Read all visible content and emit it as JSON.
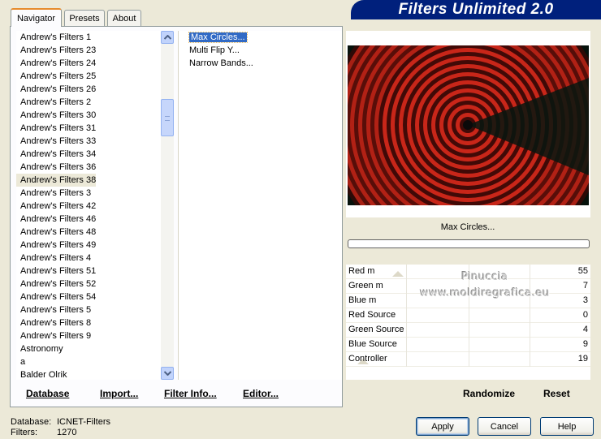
{
  "banner_title": "Filters Unlimited 2.0",
  "tabs": [
    {
      "label": "Navigator",
      "active": true
    },
    {
      "label": "Presets",
      "active": false
    },
    {
      "label": "About",
      "active": false
    }
  ],
  "categories": [
    "Andrew's Filters 1",
    "Andrew's Filters 23",
    "Andrew's Filters 24",
    "Andrew's Filters 25",
    "Andrew's Filters 26",
    "Andrew's Filters 2",
    "Andrew's Filters 30",
    "Andrew's Filters 31",
    "Andrew's Filters 33",
    "Andrew's Filters 34",
    "Andrew's Filters 36",
    "Andrew's Filters 38",
    "Andrew's Filters 3",
    "Andrew's Filters 42",
    "Andrew's Filters 46",
    "Andrew's Filters 48",
    "Andrew's Filters 49",
    "Andrew's Filters 4",
    "Andrew's Filters 51",
    "Andrew's Filters 52",
    "Andrew's Filters 54",
    "Andrew's Filters 5",
    "Andrew's Filters 8",
    "Andrew's Filters 9",
    "Astronomy",
    "a",
    "Balder Olrik"
  ],
  "selected_category": "Andrew's Filters 38",
  "filters": [
    "Max Circles...",
    "Multi Flip Y...",
    "Narrow Bands..."
  ],
  "selected_filter": "Max Circles...",
  "preview": {
    "filter_name": "Max Circles...",
    "colors": {
      "ring_dark": "#3a0806",
      "ring_light": "#d0281a",
      "background": "#0b1a14"
    }
  },
  "params": [
    {
      "name": "Red m",
      "value": "55"
    },
    {
      "name": "Green m",
      "value": "7"
    },
    {
      "name": "Blue m",
      "value": "3"
    },
    {
      "name": "Red Source",
      "value": "0"
    },
    {
      "name": "Green Source",
      "value": "4"
    },
    {
      "name": "Blue Source",
      "value": "9"
    },
    {
      "name": "Controller",
      "value": "19"
    }
  ],
  "watermark": {
    "line1": "Pinuccia",
    "line2": "www.moldiregrafica.eu"
  },
  "bottom_links": {
    "database": "Database",
    "import": "Import...",
    "filter_info": "Filter Info...",
    "editor": "Editor...",
    "randomize": "Randomize",
    "reset": "Reset"
  },
  "status": {
    "database_label": "Database:",
    "database_value": "ICNET-Filters",
    "filters_label": "Filters:",
    "filters_value": "1270"
  },
  "buttons": {
    "apply": "Apply",
    "cancel": "Cancel",
    "help": "Help"
  }
}
